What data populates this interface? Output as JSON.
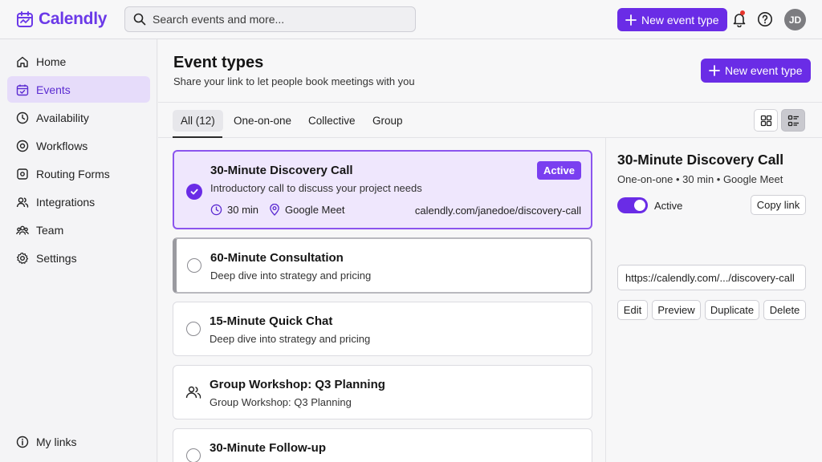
{
  "brand": {
    "name": "Calendly",
    "accent": "#6a2ce6"
  },
  "topbar": {
    "search_placeholder": "Search events and more...",
    "new_event_label": "New event type",
    "avatar_initials": "JD",
    "icons": [
      "calendar-logo-icon",
      "search-icon",
      "plus-icon",
      "bell-icon",
      "help-icon"
    ]
  },
  "sidebar": {
    "items": [
      {
        "label": "Home",
        "icon": "home-icon"
      },
      {
        "label": "Events",
        "icon": "calendar-check-icon",
        "active": true
      },
      {
        "label": "Availability",
        "icon": "clock-icon"
      },
      {
        "label": "Workflows",
        "icon": "workflow-icon"
      },
      {
        "label": "Routing Forms",
        "icon": "form-icon"
      },
      {
        "label": "Integrations",
        "icon": "integrations-icon"
      },
      {
        "label": "Team",
        "icon": "team-icon"
      },
      {
        "label": "Settings",
        "icon": "gear-icon"
      }
    ],
    "footer_label": "My links"
  },
  "header": {
    "title": "Event types",
    "subtitle": "Share your link to let people book meetings with you",
    "new_event_label": "New event type"
  },
  "tabs": [
    {
      "label": "All (12)",
      "active": true
    },
    {
      "label": "One-on-one"
    },
    {
      "label": "Collective"
    },
    {
      "label": "Group"
    }
  ],
  "events": [
    {
      "title": "30-Minute Discovery Call",
      "description": "Introductory call to discuss your project needs",
      "badge": "Active",
      "duration": "30 min",
      "location": "Google Meet",
      "link": "calendly.com/janedoe/discovery-call",
      "state": "selected"
    },
    {
      "title": "60-Minute Consultation",
      "description": "Deep dive into strategy and pricing",
      "state": "hover"
    },
    {
      "title": "15-Minute Quick Chat",
      "description": "Deep dive into strategy and pricing"
    },
    {
      "title": "Group Workshop: Q3 Planning",
      "description": "Group Workshop: Q3 Planning",
      "icon": "group-icon"
    },
    {
      "title": "30-Minute Follow-up",
      "description": ""
    }
  ],
  "details": {
    "title": "30-Minute Discovery Call",
    "subtitle": "One-on-one • 30 min • Google Meet",
    "status_label": "Active",
    "status_on": true,
    "copy_link_label": "Copy link",
    "url": "https://calendly.com/.../discovery-call",
    "actions": {
      "edit": "Edit",
      "preview": "Preview",
      "duplicate": "Duplicate",
      "delete": "Delete"
    }
  }
}
